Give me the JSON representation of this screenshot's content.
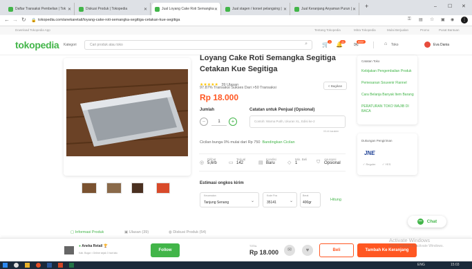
{
  "browser": {
    "tabs": [
      {
        "label": "Daftar Transaksi Pembelian | Tok"
      },
      {
        "label": "Diskusi Produk | Tokopedia"
      },
      {
        "label": "Jual Loyang Cake Roti Semangka"
      },
      {
        "label": "Jual stagen / korset pelangsing | "
      },
      {
        "label": "Jual Keranjang Anyaman Purun | "
      }
    ],
    "url": "tokopedia.com/anekaretail/loyang-cake-roti-semangka-segitiga-cetakan-kue-segitiga",
    "bookmark": "Download Tokopedia App",
    "topnav": [
      "Tentang Tokopedia",
      "Mitra Tokopedia",
      "Mulai Berjualan",
      "Promo",
      "Pusat Bantuan"
    ]
  },
  "header": {
    "logo": "tokopedia",
    "kategori": "Kategori",
    "search_placeholder": "Cari produk atau toko",
    "cart_badge": "1",
    "notif_badge": "41",
    "msg_badge": "999+",
    "toko": "Toko",
    "user": "Eva Dania"
  },
  "product": {
    "title_line1": "Loyang Cake Roti Semangka Segitiga",
    "title_line2": "Cetakan Kue Segitiga",
    "rating_stars": "★★★★★",
    "reviews": "39 Ulasan",
    "transaction": "97.87% Transaksi Sukses Dari >50 Transaksi",
    "share": "Bagikan",
    "price": "Rp 18.000",
    "qty_label": "Jumlah",
    "qty_value": "1",
    "note_label": "Catatan untuk Penjual (Opsional)",
    "note_placeholder": "Contoh: Warna Putih, Ukuran XL, Edisi ke-2",
    "note_count": "0/144 karakter",
    "installment": "Cicilan bunga 0% mulai dari Rp 750",
    "installment_link": "Bandingkan Cicilan",
    "specs": [
      {
        "label": "Dilihat",
        "value": "5,6rb"
      },
      {
        "label": "Terjual",
        "value": "142"
      },
      {
        "label": "Kondisi",
        "value": "Baru"
      },
      {
        "label": "Min. Beli",
        "value": "1"
      },
      {
        "label": "Asuransi",
        "value": "Opsional"
      }
    ],
    "shipping_title": "Estimasi ongkos kirim",
    "kecamatan_label": "Kecamatan",
    "kecamatan_value": "Tanjung Senang",
    "kodepos_label": "Kode Pos",
    "kodepos_value": "35141",
    "berat_label": "Berat",
    "berat_value": "400gr",
    "hitung": "Hitung"
  },
  "tabs_bottom": [
    "Informasi Produk",
    "Ulasan (39)",
    "Diskusi Produk (54)"
  ],
  "sidebar": {
    "title": "Catatan Toko",
    "links": [
      "Kebijakan Pengembalian Produk",
      "Pemesanan Souvenir Flannel",
      "Cara Belanja Banyak Item Barang",
      "PERATURAN TOKO WAJIB DI BACA"
    ],
    "shipping_title": "Dukungan Pengiriman",
    "courier": "JNE",
    "services": [
      "Reguler",
      "YES"
    ]
  },
  "chat": "Chat",
  "footer": {
    "shop_name": "Aneka Retail",
    "shop_info": "Kab. Bogor • Online sejak 3 hari lalu",
    "follow": "Follow",
    "total_label": "TOTAL",
    "total": "Rp 18.000",
    "beli": "Beli",
    "add_cart": "Tambah Ke Keranjang"
  },
  "watermark": {
    "line1": "Activate Windows",
    "line2": "Go to Settings to activate Windows."
  },
  "taskbar": {
    "time": "15:03",
    "lang": "ENG"
  },
  "colors": {
    "brand": "#42b549",
    "price": "#ff5722",
    "cta": "#ff5722"
  }
}
